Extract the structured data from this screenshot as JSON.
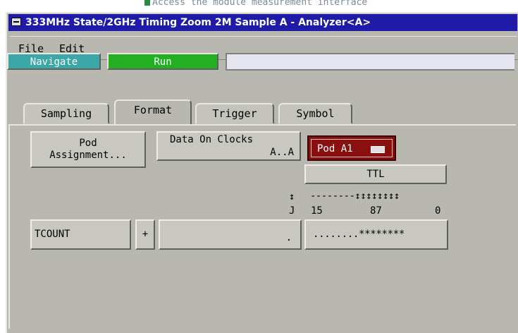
{
  "background_hint": "Access the module measurement interface",
  "window": {
    "title": "333MHz State/2GHz Timing Zoom 2M Sample A - Analyzer<A>"
  },
  "menu": {
    "items": [
      "File",
      "Edit"
    ]
  },
  "toolbar": {
    "navigate_label": "Navigate",
    "run_label": "Run",
    "command_value": ""
  },
  "tabs": [
    {
      "label": "Sampling",
      "active": false
    },
    {
      "label": "Format",
      "active": true
    },
    {
      "label": "Trigger",
      "active": false
    },
    {
      "label": "Symbol",
      "active": false
    }
  ],
  "format": {
    "pod_assignment_line1": "Pod",
    "pod_assignment_line2": "Assignment...",
    "data_on_clocks_line1": "Data On Clocks",
    "data_on_clocks_line2": "A..A",
    "pod_selector": "Pod A1",
    "threshold": "TTL",
    "clock_arrow": "↕",
    "clock_label": "J",
    "bit_header": "--------↕↕↕↕↕↕↕↕",
    "bit_15": "15",
    "bit_87": "87",
    "bit_0": "0",
    "label_name": "TCOUNT",
    "plus_label": "+",
    "value_dot": ".",
    "bit_pattern": "........********"
  },
  "colors": {
    "title_bar": "#1f1aa8",
    "navigate": "#3aa8a8",
    "run": "#22b022",
    "pod_selector": "#8a1010",
    "window_bg": "#b8b8b0"
  }
}
